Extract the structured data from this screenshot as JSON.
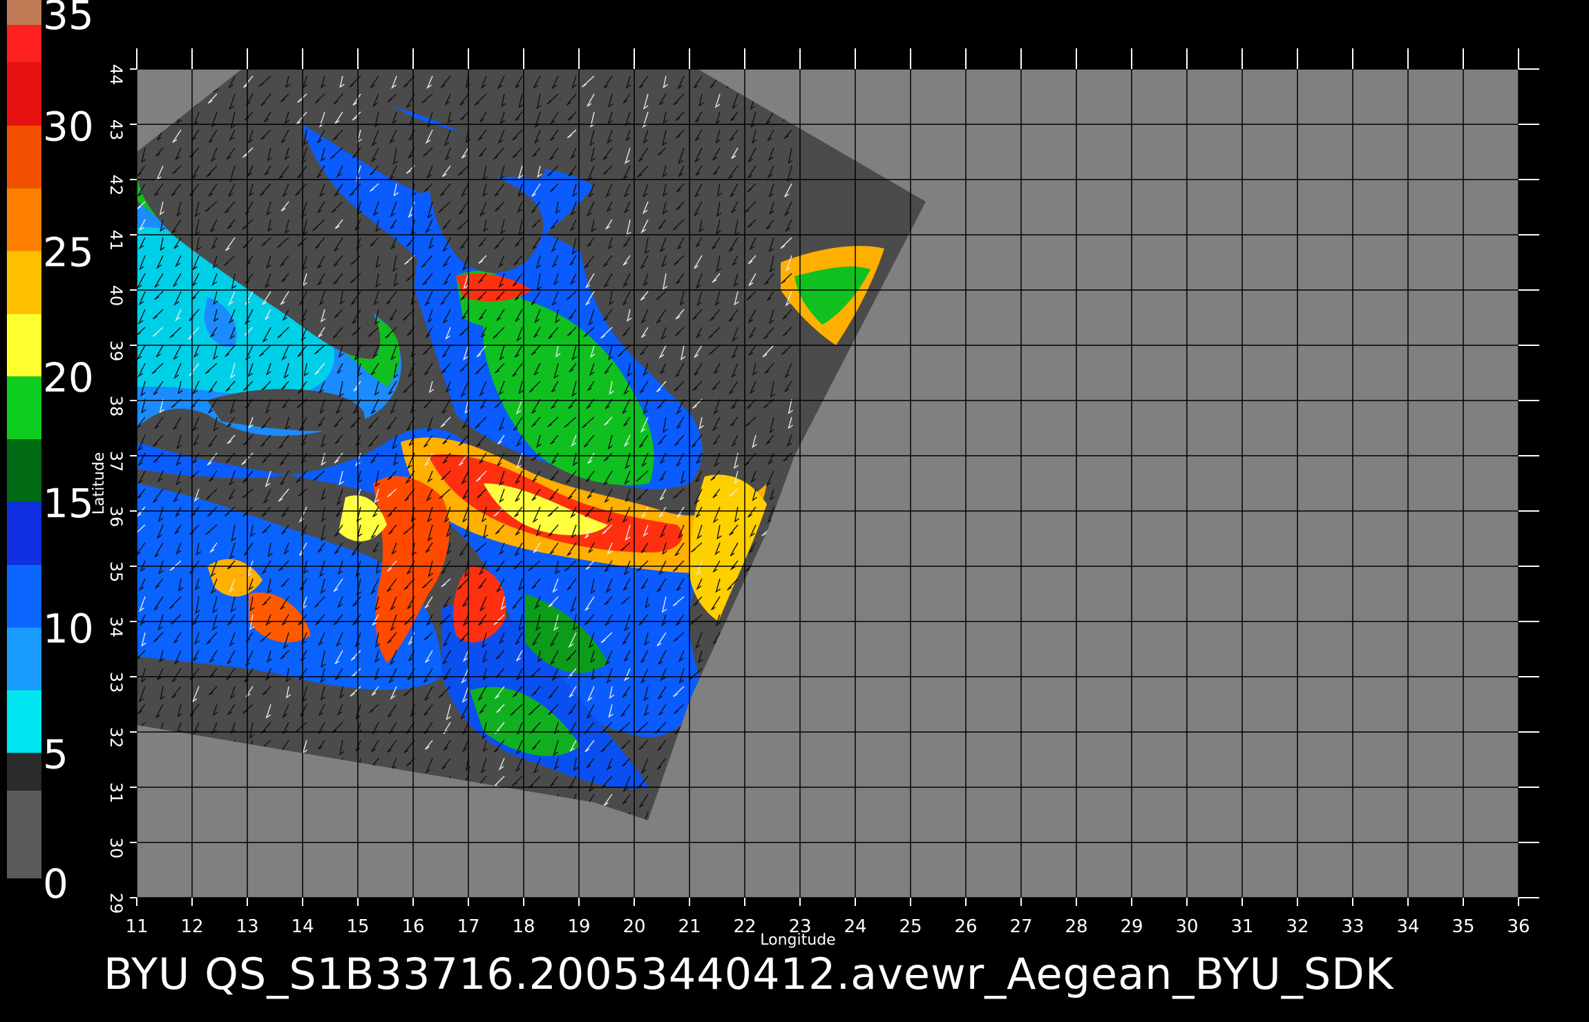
{
  "caption": "BYU  QS_S1B33716.20053440412.avewr_Aegean_BYU_SDK",
  "axes": {
    "xlabel": "Longitude",
    "ylabel": "Latitude",
    "xlim": [
      11,
      36
    ],
    "ylim": [
      29,
      44
    ],
    "xticks": [
      "11",
      "12",
      "13",
      "14",
      "15",
      "16",
      "17",
      "18",
      "19",
      "20",
      "21",
      "22",
      "23",
      "24",
      "25",
      "26",
      "27",
      "28",
      "29",
      "30",
      "31",
      "32",
      "33",
      "34",
      "35",
      "36"
    ],
    "yticks": [
      "29",
      "30",
      "31",
      "32",
      "33",
      "34",
      "35",
      "36",
      "37",
      "38",
      "39",
      "40",
      "41",
      "42",
      "43",
      "44"
    ],
    "grid": true
  },
  "colorbar": {
    "ticks": [
      "0",
      "5",
      "10",
      "15",
      "20",
      "25",
      "30",
      "35"
    ],
    "range": [
      0,
      35
    ],
    "stops": [
      {
        "from": 0,
        "to": 3.5,
        "color": "#5a5a5a"
      },
      {
        "from": 3.5,
        "to": 5,
        "color": "#2b2b2b"
      },
      {
        "from": 5,
        "to": 7.5,
        "color": "#00e5f0"
      },
      {
        "from": 7.5,
        "to": 10,
        "color": "#1a9cff"
      },
      {
        "from": 10,
        "to": 12.5,
        "color": "#0a66ff"
      },
      {
        "from": 12.5,
        "to": 15,
        "color": "#0f2fe0"
      },
      {
        "from": 15,
        "to": 17.5,
        "color": "#006a14"
      },
      {
        "from": 17.5,
        "to": 20,
        "color": "#0fcc20"
      },
      {
        "from": 20,
        "to": 22.5,
        "color": "#ffff30"
      },
      {
        "from": 22.5,
        "to": 25,
        "color": "#ffc000"
      },
      {
        "from": 25,
        "to": 27.5,
        "color": "#ff8000"
      },
      {
        "from": 27.5,
        "to": 30,
        "color": "#f05000"
      },
      {
        "from": 30,
        "to": 32.5,
        "color": "#e51010"
      },
      {
        "from": 32.5,
        "to": 34,
        "color": "#ff2020"
      },
      {
        "from": 34,
        "to": 35,
        "color": "#c07a55"
      }
    ]
  },
  "colors": {
    "background": "#000000",
    "plot_area": "#808080",
    "swath": "#4b4b4b",
    "grid": "#000000",
    "text": "#ffffff"
  }
}
